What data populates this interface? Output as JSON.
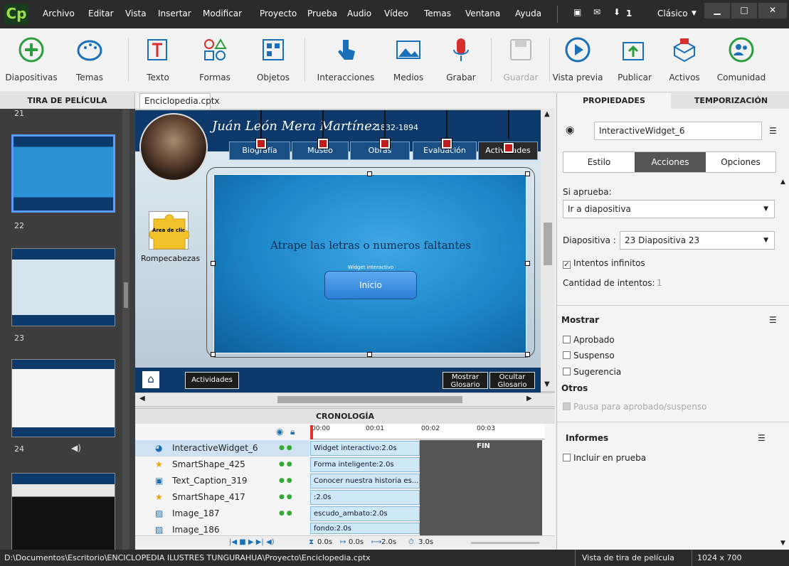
{
  "menubar": {
    "logo": "Cp",
    "items": [
      "Archivo",
      "Editar",
      "Vista",
      "Insertar",
      "Modificar",
      "Proyecto",
      "Prueba",
      "Audio",
      "Vídeo",
      "Temas",
      "Ventana",
      "Ayuda"
    ],
    "mode": "Clásico",
    "notif_count": "1"
  },
  "toolbar": {
    "items": [
      {
        "label": "Diapositivas",
        "icon": "plus-circle-icon"
      },
      {
        "label": "Temas",
        "icon": "palette-icon"
      },
      {
        "label": "Texto",
        "icon": "text-icon"
      },
      {
        "label": "Formas",
        "icon": "shapes-icon"
      },
      {
        "label": "Objetos",
        "icon": "objects-icon"
      },
      {
        "label": "Interacciones",
        "icon": "hand-pointer-icon"
      },
      {
        "label": "Medios",
        "icon": "image-icon"
      },
      {
        "label": "Grabar",
        "icon": "microphone-icon"
      },
      {
        "label": "Guardar",
        "icon": "save-icon"
      },
      {
        "label": "Vista previa",
        "icon": "play-icon"
      },
      {
        "label": "Publicar",
        "icon": "publish-icon"
      },
      {
        "label": "Activos",
        "icon": "assets-icon"
      },
      {
        "label": "Comunidad",
        "icon": "community-icon"
      }
    ]
  },
  "filmstrip": {
    "title": "TIRA DE PELÍCULA",
    "slides": [
      "21",
      "22",
      "23",
      "24"
    ]
  },
  "document": {
    "tab": "Enciclopedia.cptx",
    "close": "×"
  },
  "slide": {
    "title": "Juán León Mera Martínez",
    "dates": "1832-1894",
    "nav": [
      "Biografía",
      "Museo",
      "Obras",
      "Evaluación",
      "Actividades"
    ],
    "widget_text": "Atrape las letras o numeros faltantes",
    "widget_label": "Widget interactivo",
    "start_button": "Inicio",
    "puzzle_label": "Rompecabezas",
    "puzzle_inner": "Área de clic",
    "footer_activities": "Actividades",
    "footer_show": "Mostrar Glosario",
    "footer_hide": "Ocultar Glosario"
  },
  "timeline": {
    "title": "CRONOLOGÍA",
    "ticks": [
      "00:00",
      "00:01",
      "00:02",
      "00:03"
    ],
    "end_label": "FIN",
    "rows": [
      {
        "name": "InteractiveWidget_6",
        "bar": "Widget interactivo:2.0s",
        "icon": "widget-icon"
      },
      {
        "name": "SmartShape_425",
        "bar": "Forma inteligente:2.0s",
        "icon": "star-icon"
      },
      {
        "name": "Text_Caption_319",
        "bar": "Conocer nuestra historia es...",
        "icon": "caption-icon"
      },
      {
        "name": "SmartShape_417",
        "bar": ":2.0s",
        "icon": "star-icon"
      },
      {
        "name": "Image_187",
        "bar": "escudo_ambato:2.0s",
        "icon": "image-icon"
      },
      {
        "name": "Image_186",
        "bar": "fondo:2.0s",
        "icon": "image-icon"
      }
    ],
    "footer": [
      "0.0s",
      "0.0s",
      "2.0s",
      "3.0s"
    ]
  },
  "properties": {
    "tabs": [
      "PROPIEDADES",
      "TEMPORIZACIÓN"
    ],
    "object_name": "InteractiveWidget_6",
    "subtabs": [
      "Estilo",
      "Acciones",
      "Opciones"
    ],
    "on_success_label": "Si aprueba:",
    "on_success_value": "Ir a diapositiva",
    "slide_label": "Diapositiva :",
    "slide_value": "23 Diapositiva 23",
    "infinite_attempts": "Intentos infinitos",
    "attempts_label": "Cantidad de intentos:",
    "attempts_value": "1",
    "show_heading": "Mostrar",
    "show_items": [
      "Aprobado",
      "Suspenso",
      "Sugerencia"
    ],
    "others_heading": "Otros",
    "pause_label": "Pausa para aprobado/suspenso",
    "reports_heading": "Informes",
    "include_quiz": "Incluir en prueba"
  },
  "status": {
    "path": "D:\\Documentos\\Escritorio\\ENCICLOPEDIA ILUSTRES TUNGURAHUA\\Proyecto\\Enciclopedia.cptx",
    "view": "Vista de tira de película",
    "size": "1024 x 700"
  }
}
